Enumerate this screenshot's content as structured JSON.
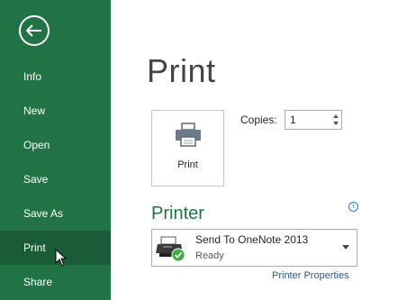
{
  "sidebar": {
    "items": [
      {
        "label": "Info"
      },
      {
        "label": "New"
      },
      {
        "label": "Open"
      },
      {
        "label": "Save"
      },
      {
        "label": "Save As"
      },
      {
        "label": "Print"
      },
      {
        "label": "Share"
      }
    ],
    "active": "Print"
  },
  "main": {
    "title": "Print",
    "print_button_label": "Print",
    "copies_label": "Copies:",
    "copies_value": "1",
    "printer_section_title": "Printer",
    "printer_name": "Send To OneNote 2013",
    "printer_status": "Ready",
    "printer_properties_link": "Printer Properties",
    "info_icon_glyph": "i"
  },
  "colors": {
    "brand": "#217346",
    "active_item": "#1a5c38",
    "link": "#2b579a"
  }
}
